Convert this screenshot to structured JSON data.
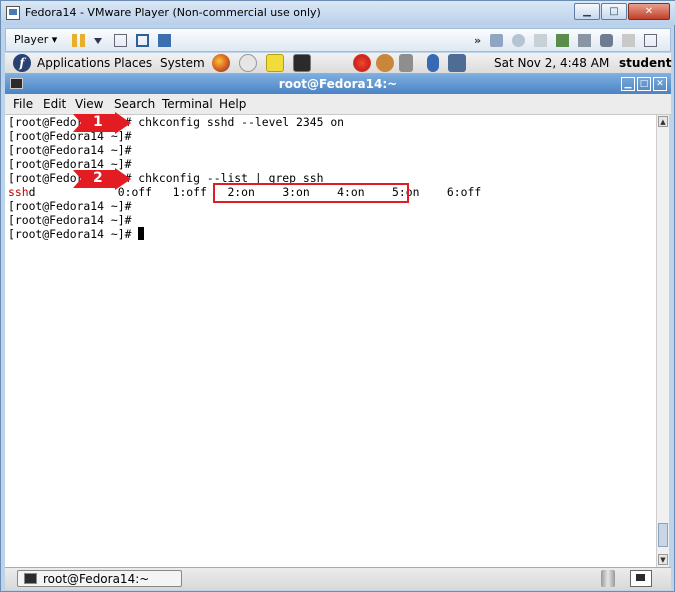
{
  "vmware": {
    "title": "Fedora14 - VMware Player (Non-commercial use only)",
    "player_label": "Player ▾",
    "window_buttons": {
      "minimize": "▁",
      "maximize": "□",
      "close": "✕"
    }
  },
  "panel": {
    "logo": "f",
    "menus": [
      "Applications",
      "Places",
      "System"
    ],
    "clock": "Sat Nov  2,  4:48 AM",
    "user": "student"
  },
  "terminal": {
    "title": "root@Fedora14:~",
    "menus": [
      "File",
      "Edit",
      "View",
      "Search",
      "Terminal",
      "Help"
    ],
    "lines": [
      "[root@Fedora14 ~]# chkconfig sshd --level 2345 on",
      "[root@Fedora14 ~]#",
      "[root@Fedora14 ~]#",
      "[root@Fedora14 ~]#",
      "[root@Fedora14 ~]# chkconfig --list | grep ssh",
      "d            0:off   1:off   2:on    3:on    4:on    5:on    6:off",
      "[root@Fedora14 ~]#",
      "[root@Fedora14 ~]#",
      "[root@Fedora14 ~]# "
    ],
    "grep_match": "ssh",
    "scroll_up": "▲",
    "scroll_down": "▼"
  },
  "callouts": [
    "1",
    "2"
  ],
  "taskbar": {
    "task_label": "root@Fedora14:~"
  },
  "colors": {
    "callout_red": "#e31b23",
    "title_blue": "#4a83c4",
    "grep_red": "#c00000"
  }
}
